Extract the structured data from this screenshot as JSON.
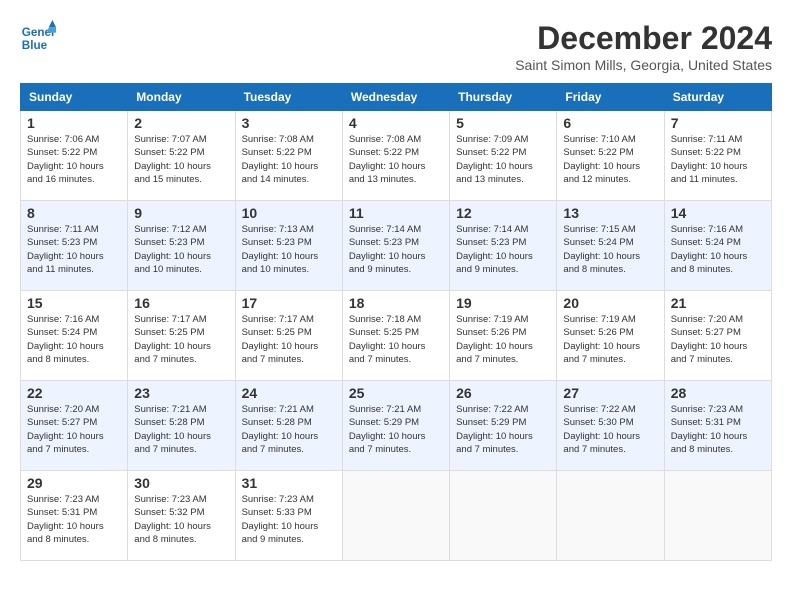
{
  "header": {
    "logo_line1": "General",
    "logo_line2": "Blue",
    "month": "December 2024",
    "location": "Saint Simon Mills, Georgia, United States"
  },
  "days_of_week": [
    "Sunday",
    "Monday",
    "Tuesday",
    "Wednesday",
    "Thursday",
    "Friday",
    "Saturday"
  ],
  "weeks": [
    [
      {
        "day": "1",
        "info": "Sunrise: 7:06 AM\nSunset: 5:22 PM\nDaylight: 10 hours\nand 16 minutes."
      },
      {
        "day": "2",
        "info": "Sunrise: 7:07 AM\nSunset: 5:22 PM\nDaylight: 10 hours\nand 15 minutes."
      },
      {
        "day": "3",
        "info": "Sunrise: 7:08 AM\nSunset: 5:22 PM\nDaylight: 10 hours\nand 14 minutes."
      },
      {
        "day": "4",
        "info": "Sunrise: 7:08 AM\nSunset: 5:22 PM\nDaylight: 10 hours\nand 13 minutes."
      },
      {
        "day": "5",
        "info": "Sunrise: 7:09 AM\nSunset: 5:22 PM\nDaylight: 10 hours\nand 13 minutes."
      },
      {
        "day": "6",
        "info": "Sunrise: 7:10 AM\nSunset: 5:22 PM\nDaylight: 10 hours\nand 12 minutes."
      },
      {
        "day": "7",
        "info": "Sunrise: 7:11 AM\nSunset: 5:22 PM\nDaylight: 10 hours\nand 11 minutes."
      }
    ],
    [
      {
        "day": "8",
        "info": "Sunrise: 7:11 AM\nSunset: 5:23 PM\nDaylight: 10 hours\nand 11 minutes."
      },
      {
        "day": "9",
        "info": "Sunrise: 7:12 AM\nSunset: 5:23 PM\nDaylight: 10 hours\nand 10 minutes."
      },
      {
        "day": "10",
        "info": "Sunrise: 7:13 AM\nSunset: 5:23 PM\nDaylight: 10 hours\nand 10 minutes."
      },
      {
        "day": "11",
        "info": "Sunrise: 7:14 AM\nSunset: 5:23 PM\nDaylight: 10 hours\nand 9 minutes."
      },
      {
        "day": "12",
        "info": "Sunrise: 7:14 AM\nSunset: 5:23 PM\nDaylight: 10 hours\nand 9 minutes."
      },
      {
        "day": "13",
        "info": "Sunrise: 7:15 AM\nSunset: 5:24 PM\nDaylight: 10 hours\nand 8 minutes."
      },
      {
        "day": "14",
        "info": "Sunrise: 7:16 AM\nSunset: 5:24 PM\nDaylight: 10 hours\nand 8 minutes."
      }
    ],
    [
      {
        "day": "15",
        "info": "Sunrise: 7:16 AM\nSunset: 5:24 PM\nDaylight: 10 hours\nand 8 minutes."
      },
      {
        "day": "16",
        "info": "Sunrise: 7:17 AM\nSunset: 5:25 PM\nDaylight: 10 hours\nand 7 minutes."
      },
      {
        "day": "17",
        "info": "Sunrise: 7:17 AM\nSunset: 5:25 PM\nDaylight: 10 hours\nand 7 minutes."
      },
      {
        "day": "18",
        "info": "Sunrise: 7:18 AM\nSunset: 5:25 PM\nDaylight: 10 hours\nand 7 minutes."
      },
      {
        "day": "19",
        "info": "Sunrise: 7:19 AM\nSunset: 5:26 PM\nDaylight: 10 hours\nand 7 minutes."
      },
      {
        "day": "20",
        "info": "Sunrise: 7:19 AM\nSunset: 5:26 PM\nDaylight: 10 hours\nand 7 minutes."
      },
      {
        "day": "21",
        "info": "Sunrise: 7:20 AM\nSunset: 5:27 PM\nDaylight: 10 hours\nand 7 minutes."
      }
    ],
    [
      {
        "day": "22",
        "info": "Sunrise: 7:20 AM\nSunset: 5:27 PM\nDaylight: 10 hours\nand 7 minutes."
      },
      {
        "day": "23",
        "info": "Sunrise: 7:21 AM\nSunset: 5:28 PM\nDaylight: 10 hours\nand 7 minutes."
      },
      {
        "day": "24",
        "info": "Sunrise: 7:21 AM\nSunset: 5:28 PM\nDaylight: 10 hours\nand 7 minutes."
      },
      {
        "day": "25",
        "info": "Sunrise: 7:21 AM\nSunset: 5:29 PM\nDaylight: 10 hours\nand 7 minutes."
      },
      {
        "day": "26",
        "info": "Sunrise: 7:22 AM\nSunset: 5:29 PM\nDaylight: 10 hours\nand 7 minutes."
      },
      {
        "day": "27",
        "info": "Sunrise: 7:22 AM\nSunset: 5:30 PM\nDaylight: 10 hours\nand 7 minutes."
      },
      {
        "day": "28",
        "info": "Sunrise: 7:23 AM\nSunset: 5:31 PM\nDaylight: 10 hours\nand 8 minutes."
      }
    ],
    [
      {
        "day": "29",
        "info": "Sunrise: 7:23 AM\nSunset: 5:31 PM\nDaylight: 10 hours\nand 8 minutes."
      },
      {
        "day": "30",
        "info": "Sunrise: 7:23 AM\nSunset: 5:32 PM\nDaylight: 10 hours\nand 8 minutes."
      },
      {
        "day": "31",
        "info": "Sunrise: 7:23 AM\nSunset: 5:33 PM\nDaylight: 10 hours\nand 9 minutes."
      },
      {
        "day": "",
        "info": ""
      },
      {
        "day": "",
        "info": ""
      },
      {
        "day": "",
        "info": ""
      },
      {
        "day": "",
        "info": ""
      }
    ]
  ]
}
